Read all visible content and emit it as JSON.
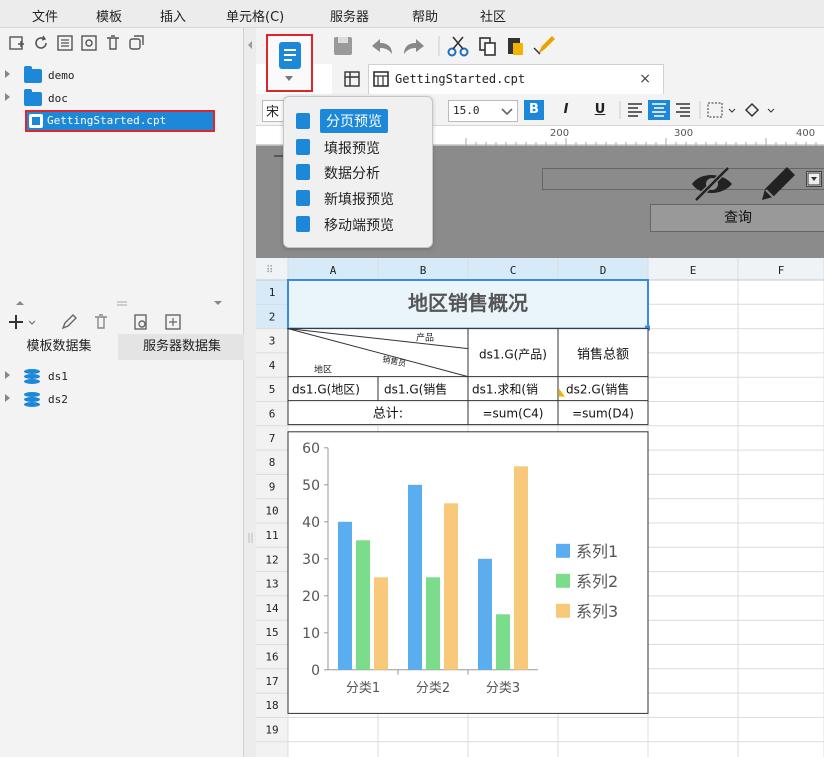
{
  "menubar": {
    "items": [
      "文件",
      "模板",
      "插入",
      "单元格(C)",
      "服务器",
      "帮助",
      "社区"
    ]
  },
  "file_tree": {
    "folders": [
      "demo",
      "doc"
    ],
    "selected_file": "GettingStarted.cpt"
  },
  "dataset_tabs": [
    "模板数据集",
    "服务器数据集"
  ],
  "datasets": [
    "ds1",
    "ds2"
  ],
  "editor": {
    "tab_title": "GettingStarted.cpt",
    "tab_close": "×",
    "font_name": "宋",
    "font_size": "15.0",
    "bold": "B",
    "italic": "I",
    "underline": "U",
    "ruler_marks": [
      "200",
      "300",
      "400"
    ],
    "query_button": "查询"
  },
  "preview_menu": {
    "items": [
      "分页预览",
      "填报预览",
      "数据分析",
      "新填报预览",
      "移动端预览"
    ]
  },
  "sheet": {
    "columns": [
      "A",
      "B",
      "C",
      "D",
      "E",
      "F"
    ],
    "rows": [
      "1",
      "2",
      "3",
      "4",
      "5",
      "6",
      "7",
      "8",
      "9",
      "10",
      "11",
      "12",
      "13",
      "14",
      "15",
      "16",
      "17",
      "18",
      "19"
    ],
    "title": "地区销售概况",
    "header": {
      "diag_top": "产品",
      "diag_mid": "销售员",
      "diag_bot": "地区",
      "c3": "ds1.G(产品)",
      "d3": "销售总额"
    },
    "row4": {
      "a": "ds1.G(地区)",
      "b": "ds1.G(销售",
      "c": "ds1.求和(销",
      "d": "ds2.G(销售"
    },
    "row5": {
      "label": "总计:",
      "c": "=sum(C4)",
      "d": "=sum(D4)"
    }
  },
  "chart_data": {
    "type": "bar",
    "categories": [
      "分类1",
      "分类2",
      "分类3"
    ],
    "series": [
      {
        "name": "系列1",
        "values": [
          40,
          50,
          30
        ],
        "color": "#5aaef0"
      },
      {
        "name": "系列2",
        "values": [
          35,
          25,
          15
        ],
        "color": "#7bdc8c"
      },
      {
        "name": "系列3",
        "values": [
          25,
          45,
          55
        ],
        "color": "#f8c97a"
      }
    ],
    "y_ticks": [
      "0",
      "10",
      "20",
      "30",
      "40",
      "50",
      "60"
    ],
    "ylim": [
      0,
      60
    ],
    "legend": "right",
    "grid": false
  },
  "icons": {
    "preview": "page-preview-icon",
    "hide": "eye-slash-icon",
    "edit": "pencil-icon"
  }
}
